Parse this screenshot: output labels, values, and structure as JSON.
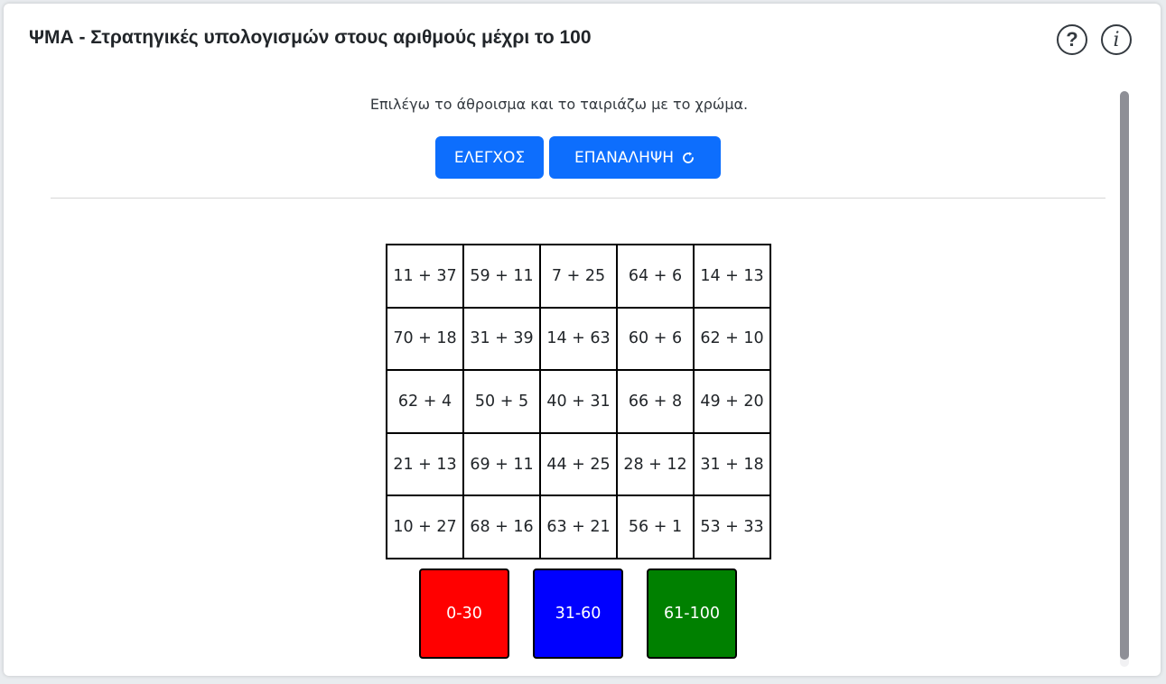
{
  "header": {
    "title": "ΨΜΑ - Στρατηγικές υπολογισμών στους αριθμούς μέχρι το 100",
    "help_icon": "?",
    "info_icon": "i"
  },
  "instruction": "Επιλέγω το άθροισμα και το ταιριάζω με το χρώμα.",
  "buttons": {
    "check_label": "ΕΛΕΓΧΟΣ",
    "repeat_label": "ΕΠΑΝΑΛΗΨΗ"
  },
  "grid": [
    [
      "11 + 37",
      "59 + 11",
      "7 + 25",
      "64 + 6",
      "14 + 13"
    ],
    [
      "70 + 18",
      "31 + 39",
      "14 + 63",
      "60 + 6",
      "62 + 10"
    ],
    [
      "62 + 4",
      "50 + 5",
      "40 + 31",
      "66 + 8",
      "49 + 20"
    ],
    [
      "21 + 13",
      "69 + 11",
      "44 + 25",
      "28 + 12",
      "31 + 18"
    ],
    [
      "10 + 27",
      "68 + 16",
      "63 + 21",
      "56 + 1",
      "53 + 33"
    ]
  ],
  "swatches": [
    {
      "label": "0-30",
      "color": "#ff0000"
    },
    {
      "label": "31-60",
      "color": "#0000ff"
    },
    {
      "label": "61-100",
      "color": "#008000"
    }
  ],
  "colors": {
    "accent": "#0d6efd"
  }
}
